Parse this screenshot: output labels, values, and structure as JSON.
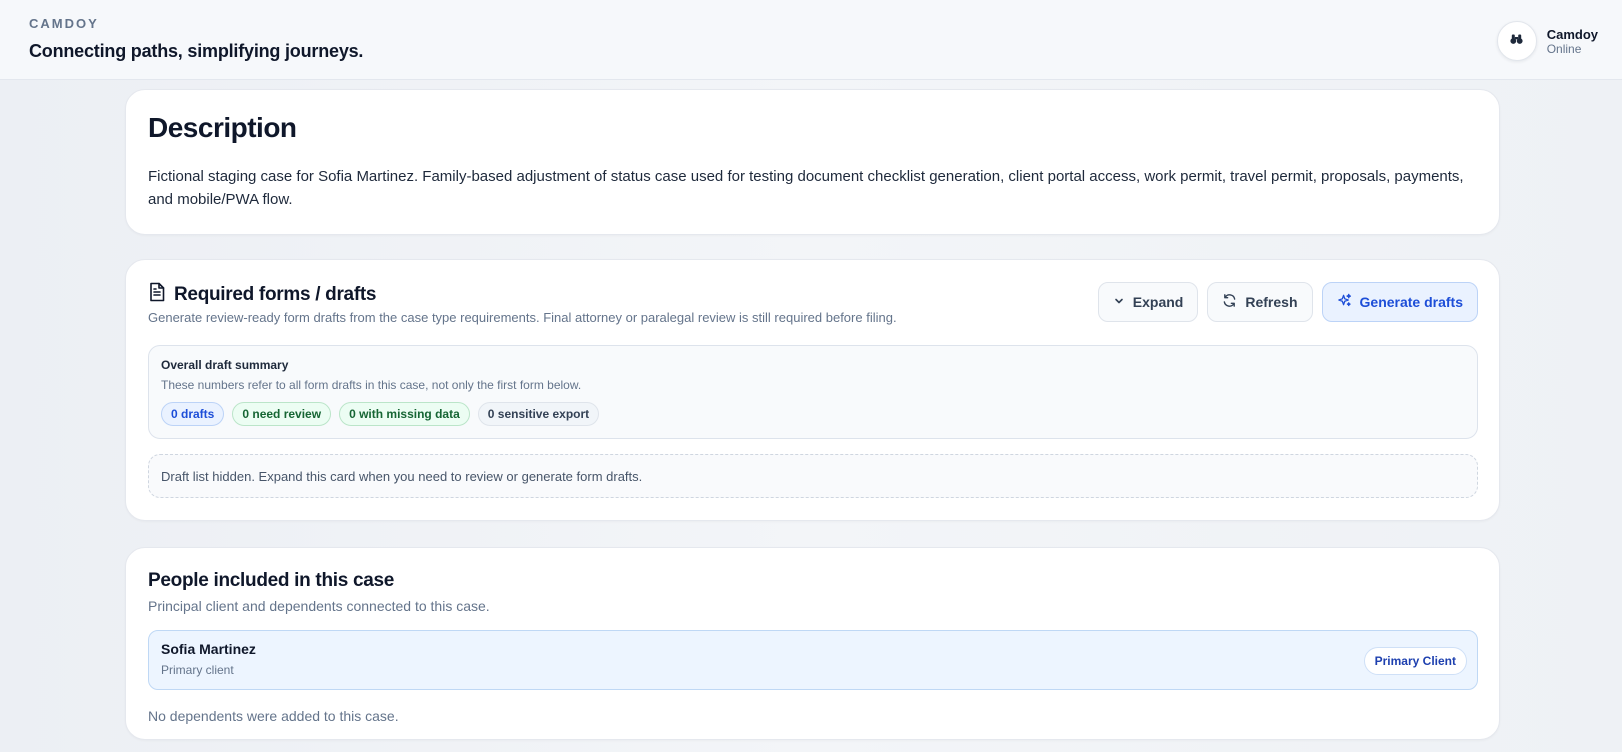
{
  "header": {
    "brand": "CAMDOY",
    "tagline": "Connecting paths, simplifying journeys.",
    "user_name": "Camdoy",
    "user_status": "Online",
    "avatar_icon": "binoculars-icon"
  },
  "description": {
    "title": "Description",
    "text": "Fictional staging case for Sofia Martinez. Family-based adjustment of status case used for testing document checklist generation, client portal access, work permit, travel permit, proposals, payments, and mobile/PWA flow."
  },
  "forms": {
    "icon": "document-icon",
    "title": "Required forms / drafts",
    "subtitle": "Generate review-ready form drafts from the case type requirements. Final attorney or paralegal review is still required before filing.",
    "buttons": {
      "expand": "Expand",
      "refresh": "Refresh",
      "generate": "Generate drafts"
    },
    "summary": {
      "title": "Overall draft summary",
      "subtitle": "These numbers refer to all form drafts in this case, not only the first form below.",
      "chips": {
        "drafts": "0 drafts",
        "need_review": "0 need review",
        "missing_data": "0 with missing data",
        "sensitive_export": "0 sensitive export"
      }
    },
    "hidden_note": "Draft list hidden. Expand this card when you need to review or generate form drafts."
  },
  "people": {
    "title": "People included in this case",
    "subtitle": "Principal client and dependents connected to this case.",
    "primary": {
      "name": "Sofia Martinez",
      "role": "Primary client",
      "badge": "Primary Client"
    },
    "no_dependents": "No dependents were added to this case."
  },
  "colors": {
    "accent": "#1d4ed8",
    "background": "#eef1f5",
    "card": "#ffffff",
    "success": "#166534"
  }
}
